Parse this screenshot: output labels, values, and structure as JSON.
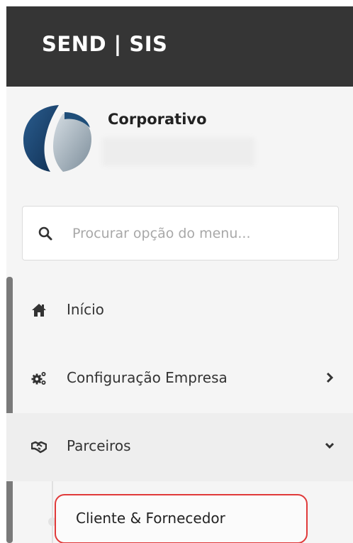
{
  "header": {
    "brand": "SEND | SIS"
  },
  "profile": {
    "company": "Corporativo"
  },
  "search": {
    "placeholder": "Procurar opção do menu..."
  },
  "menu": {
    "items": [
      {
        "label": "Início",
        "icon": "home-icon"
      },
      {
        "label": "Configuração Empresa",
        "icon": "gears-icon",
        "chevron": "chevron-right-icon"
      },
      {
        "label": "Parceiros",
        "icon": "handshake-icon",
        "chevron": "chevron-down-icon",
        "expanded": true
      }
    ],
    "submenu": [
      {
        "label": "Cliente & Fornecedor"
      }
    ]
  },
  "colors": {
    "topbar": "#353535",
    "sidebar": "#f5f5f5",
    "highlight": "#e03a3a",
    "logo_dark": "#1f4e79",
    "logo_light": "#a9b6c0"
  }
}
